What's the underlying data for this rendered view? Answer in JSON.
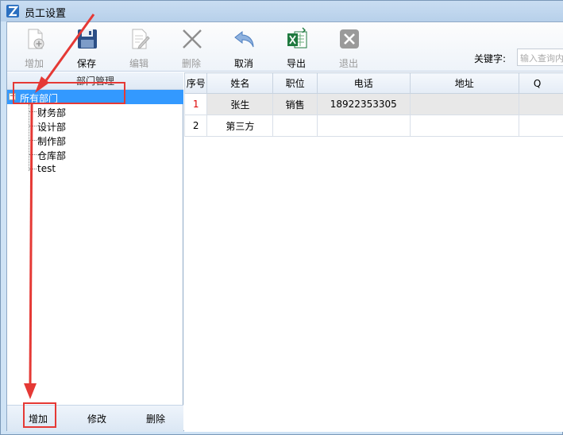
{
  "window": {
    "title": "员工设置"
  },
  "toolbar": {
    "add_label": "增加",
    "save_label": "保存",
    "edit_label": "编辑",
    "delete_label": "删除",
    "cancel_label": "取消",
    "export_label": "导出",
    "exit_label": "退出",
    "keyword_label": "关键字:",
    "keyword_placeholder": "输入查询内"
  },
  "department_panel": {
    "header": "部门管理",
    "root": "所有部门",
    "items": [
      "财务部",
      "设计部",
      "制作部",
      "仓库部",
      "test"
    ],
    "add_label": "增加",
    "modify_label": "修改",
    "delete_label": "删除"
  },
  "employee_table": {
    "columns": [
      "序号",
      "姓名",
      "职位",
      "电话",
      "地址",
      "Q"
    ],
    "rows": [
      {
        "no": "1",
        "name": "张生",
        "position": "销售",
        "phone": "18922353305",
        "address": "",
        "q": ""
      },
      {
        "no": "2",
        "name": "第三方",
        "position": "",
        "phone": "",
        "address": "",
        "q": ""
      }
    ]
  },
  "icons": {
    "add": "add-page-icon",
    "save": "floppy-disk-icon",
    "edit": "edit-page-icon",
    "delete": "x-mark-icon",
    "cancel": "undo-arrow-icon",
    "export": "excel-icon",
    "exit": "close-box-icon"
  },
  "colors": {
    "selection": "#3399ff",
    "annotation": "#e53935",
    "row_number_red": "#dd0000"
  }
}
